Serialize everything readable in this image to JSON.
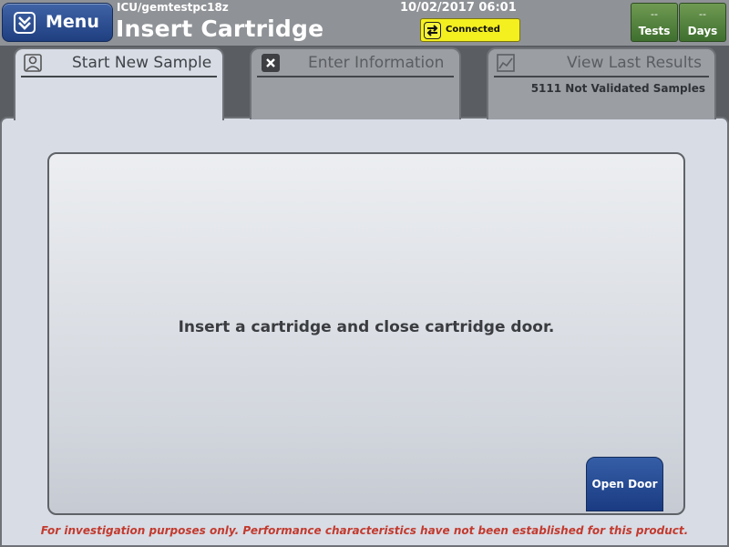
{
  "header": {
    "menu_label": "Menu",
    "location": "ICU/gemtestpc18z",
    "title": "Insert Cartridge",
    "datetime": "10/02/2017 06:01",
    "connection": {
      "label": "Connected",
      "icon": "connected-arrows-icon",
      "color": "#f4ef1f"
    },
    "counters": [
      {
        "value": "--",
        "label": "Tests"
      },
      {
        "value": "--",
        "label": "Days"
      }
    ]
  },
  "tabs": [
    {
      "label": "Start New Sample",
      "icon": "sample-cup-icon",
      "state": "active"
    },
    {
      "label": "Enter Information",
      "icon": "close-icon",
      "state": "inactive"
    },
    {
      "label": "View Last Results",
      "icon": "chart-icon",
      "state": "inactive",
      "subtext": "5111 Not Validated Samples"
    }
  ],
  "main": {
    "message": "Insert a cartridge and close cartridge door.",
    "open_door_label": "Open Door"
  },
  "footer": {
    "disclaimer": "For investigation purposes only.  Performance characteristics have not been established for this product."
  },
  "colors": {
    "accent_blue": "#1f3f80",
    "counter_green": "#3f6f2f",
    "warning_red": "#c33a2e"
  }
}
